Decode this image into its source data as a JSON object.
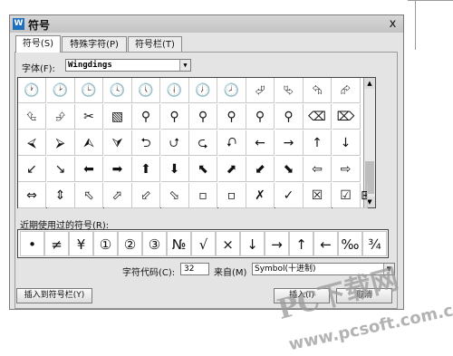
{
  "window": {
    "title": "符号",
    "app_icon": "W",
    "close_label": "x"
  },
  "tabs": [
    {
      "label": "符号(S)"
    },
    {
      "label": "特殊字符(P)"
    },
    {
      "label": "符号栏(T)"
    }
  ],
  "font": {
    "label": "字体(F):",
    "value": "Wingdings"
  },
  "symbol_grid": [
    [
      "🕐",
      "🕑",
      "🕒",
      "🕓",
      "🕔",
      "🕕",
      "🕖",
      "🕗",
      "⮰",
      "⮱",
      "⮲",
      "⮳"
    ],
    [
      "⮴",
      "⮵",
      "✂",
      "▧",
      "⚲",
      "⚲",
      "⚲",
      "⚲",
      "⚲",
      "⚲",
      "⌫",
      "⌦"
    ],
    [
      "⮘",
      "⮚",
      "⮙",
      "⮛",
      "⮌",
      "⮍",
      "⮎",
      "⮏",
      "←",
      "→",
      "↑",
      "↓"
    ],
    [
      "↙",
      "↘",
      "⬅",
      "➡",
      "⬆",
      "⬇",
      "⬉",
      "⬈",
      "⬋",
      "⬊",
      "⇦",
      "⇨"
    ],
    [
      "⇔",
      "⇕",
      "⬁",
      "⬀",
      "⬃",
      "⬂",
      "▫",
      "▫",
      "✗",
      "✓",
      "☒",
      "☑"
    ]
  ],
  "extra_symbol": "⊞",
  "recent": {
    "label": "近期使用过的符号(R):",
    "symbols": [
      "•",
      "≠",
      "¥",
      "①",
      "②",
      "③",
      "№",
      "√",
      "×",
      "↓",
      "→",
      "↑",
      "←",
      "‰",
      "¾"
    ]
  },
  "char_code": {
    "label": "字符代码(C):",
    "value": "32"
  },
  "from": {
    "label": "来自(M)",
    "value": "Symbol(十进制)"
  },
  "buttons": {
    "insert_to_bar": "插入到符号栏(Y)",
    "insert": "插入(I)",
    "cancel": "取消"
  },
  "watermark": {
    "brand": "PC下载网",
    "url": "www.pcsoft.com.cn"
  }
}
